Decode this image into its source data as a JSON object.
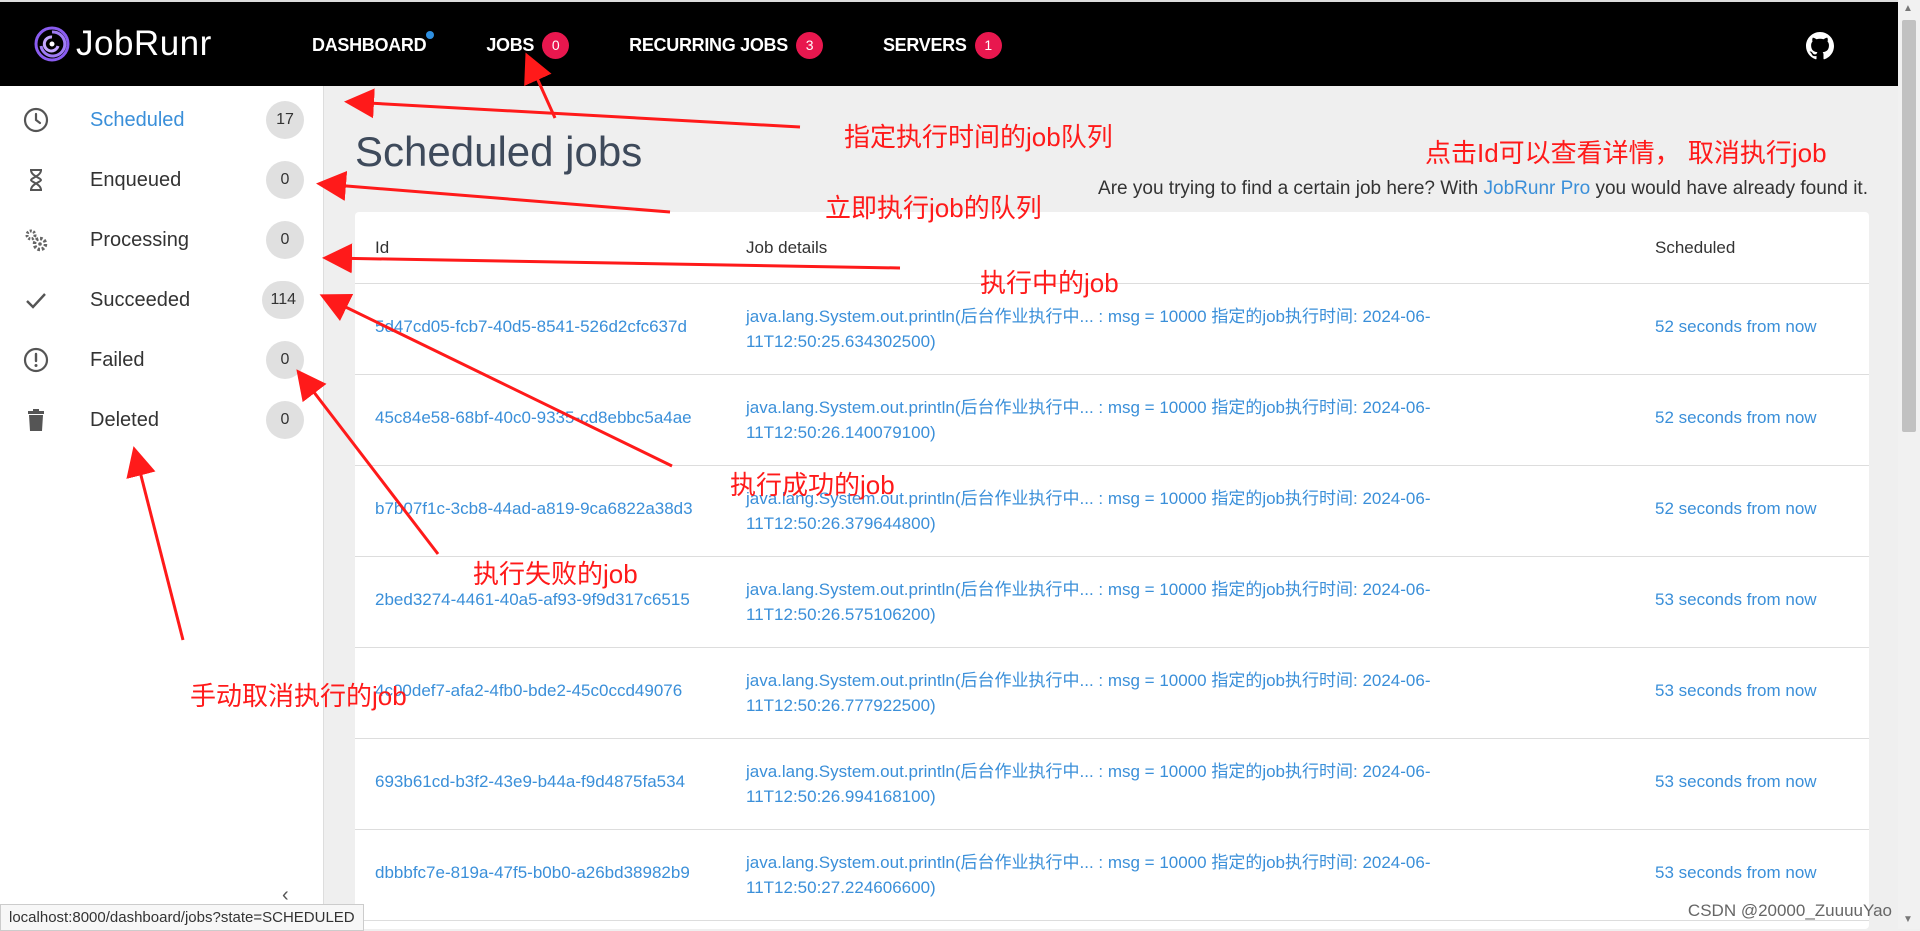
{
  "app": {
    "name": "JobRunr"
  },
  "nav": [
    {
      "label": "DASHBOARD",
      "badge": null,
      "dot": true
    },
    {
      "label": "JOBS",
      "badge": "0"
    },
    {
      "label": "RECURRING JOBS",
      "badge": "3"
    },
    {
      "label": "SERVERS",
      "badge": "1"
    }
  ],
  "sidebar": {
    "items": [
      {
        "label": "Scheduled",
        "count": "17",
        "icon": "clock-icon",
        "active": true
      },
      {
        "label": "Enqueued",
        "count": "0",
        "icon": "hourglass-icon"
      },
      {
        "label": "Processing",
        "count": "0",
        "icon": "gears-icon"
      },
      {
        "label": "Succeeded",
        "count": "114",
        "icon": "check-icon"
      },
      {
        "label": "Failed",
        "count": "0",
        "icon": "exclamation-circle-icon"
      },
      {
        "label": "Deleted",
        "count": "0",
        "icon": "trash-icon"
      }
    ],
    "collapse": "‹"
  },
  "page": {
    "title": "Scheduled jobs",
    "promo_prefix": "Are you trying to find a certain job here? With ",
    "promo_link": "JobRunr Pro",
    "promo_suffix": " you would have already found it."
  },
  "table": {
    "headers": {
      "id": "Id",
      "details": "Job details",
      "scheduled": "Scheduled"
    },
    "rows": [
      {
        "id": "5d47cd05-fcb7-40d5-8541-526d2cfc637d",
        "details": "java.lang.System.out.println(后台作业执行中... : msg = 10000 指定的job执行时间: 2024-06-11T12:50:25.634302500)",
        "scheduled": "52 seconds from now"
      },
      {
        "id": "45c84e58-68bf-40c0-9335-cd8ebbc5a4ae",
        "details": "java.lang.System.out.println(后台作业执行中... : msg = 10000 指定的job执行时间: 2024-06-11T12:50:26.140079100)",
        "scheduled": "52 seconds from now"
      },
      {
        "id": "b7b07f1c-3cb8-44ad-a819-9ca6822a38d3",
        "details": "java.lang.System.out.println(后台作业执行中... : msg = 10000 指定的job执行时间: 2024-06-11T12:50:26.379644800)",
        "scheduled": "52 seconds from now"
      },
      {
        "id": "2bed3274-4461-40a5-af93-9f9d317c6515",
        "details": "java.lang.System.out.println(后台作业执行中... : msg = 10000 指定的job执行时间: 2024-06-11T12:50:26.575106200)",
        "scheduled": "53 seconds from now"
      },
      {
        "id": "4c00def7-afa2-4fb0-bde2-45c0ccd49076",
        "details": "java.lang.System.out.println(后台作业执行中... : msg = 10000 指定的job执行时间: 2024-06-11T12:50:26.777922500)",
        "scheduled": "53 seconds from now"
      },
      {
        "id": "693b61cd-b3f2-43e9-b44a-f9d4875fa534",
        "details": "java.lang.System.out.println(后台作业执行中... : msg = 10000 指定的job执行时间: 2024-06-11T12:50:26.994168100)",
        "scheduled": "53 seconds from now"
      },
      {
        "id": "dbbbfc7e-819a-47f5-b0b0-a26bd38982b9",
        "details": "java.lang.System.out.println(后台作业执行中... : msg = 10000 指定的job执行时间: 2024-06-11T12:50:27.224606600)",
        "scheduled": "53 seconds from now"
      }
    ]
  },
  "status_url": "localhost:8000/dashboard/jobs?state=SCHEDULED",
  "watermark": "CSDN @20000_ZuuuuYao",
  "annotations": {
    "scheduled": "指定执行时间的job队列",
    "detail": "点击Id可以查看详情， 取消执行job",
    "enqueued": "立即执行job的队列",
    "processing": "执行中的job",
    "succeeded": "执行成功的job",
    "failed": "执行失败的job",
    "deleted": "手动取消执行的job"
  },
  "colors": {
    "accent": "#3a8fd9",
    "badge": "#e8174e",
    "annotation": "#ff1a1a",
    "topbar": "#000000"
  }
}
